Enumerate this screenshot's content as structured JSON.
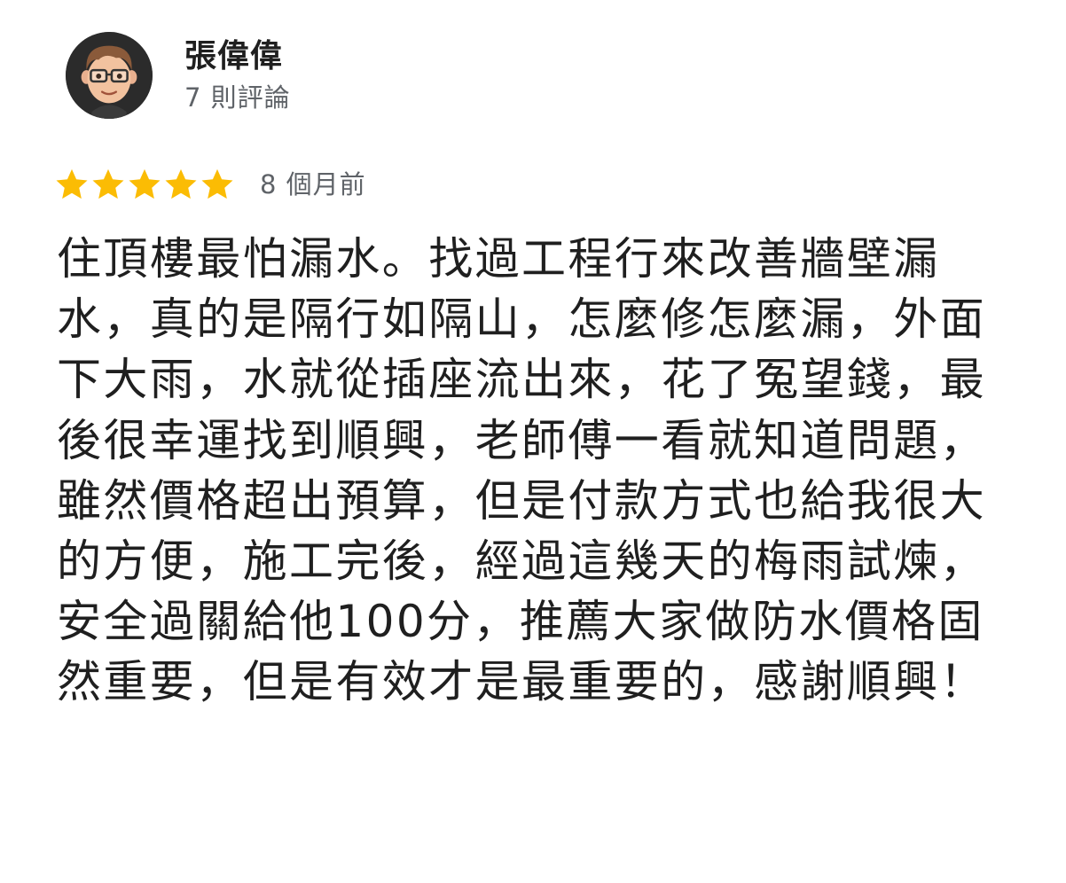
{
  "review": {
    "author_name": "張偉偉",
    "author_review_count": "7 則評論",
    "rating": 5,
    "rating_max": 5,
    "star_color": "#fbbc04",
    "date": "8 個月前",
    "text": "住頂樓最怕漏水。找過工程行來改善牆壁漏水，真的是隔行如隔山，怎麼修怎麼漏，外面下大雨，水就從插座流出來，花了冤望錢，最後很幸運找到順興，老師傅一看就知道問題，雖然價格超出預算，但是付款方式也給我很大的方便，施工完後，經過這幾天的梅雨試煉，安全過關給他100分，推薦大家做防水價格固然重要，但是有效才是最重要的，感謝順興！"
  }
}
